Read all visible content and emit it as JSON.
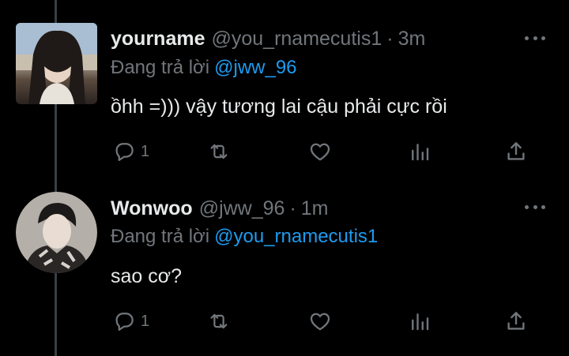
{
  "colors": {
    "background": "#000000",
    "text_primary": "#e7e9ea",
    "text_secondary": "#71767b",
    "mention": "#1d9bf0",
    "thread_line": "#3a3f44"
  },
  "tweets": [
    {
      "display_name": "yourname",
      "handle": "@you_rnamecutis1",
      "separator": "·",
      "time": "3m",
      "reply_prefix": "Đang trả lời",
      "reply_to": "@jww_96",
      "text": "ồhh =))) vậy tương lai cậu phải cực rồi",
      "reply_count": "1",
      "icons": [
        "reply-icon",
        "retweet-icon",
        "like-icon",
        "analytics-icon",
        "share-icon",
        "more-icon"
      ]
    },
    {
      "display_name": "Wonwoo",
      "handle": "@jww_96",
      "separator": "·",
      "time": "1m",
      "reply_prefix": "Đang trả lời",
      "reply_to": "@you_rnamecutis1",
      "text": "sao cơ?",
      "reply_count": "1",
      "icons": [
        "reply-icon",
        "retweet-icon",
        "like-icon",
        "analytics-icon",
        "share-icon",
        "more-icon"
      ]
    }
  ]
}
